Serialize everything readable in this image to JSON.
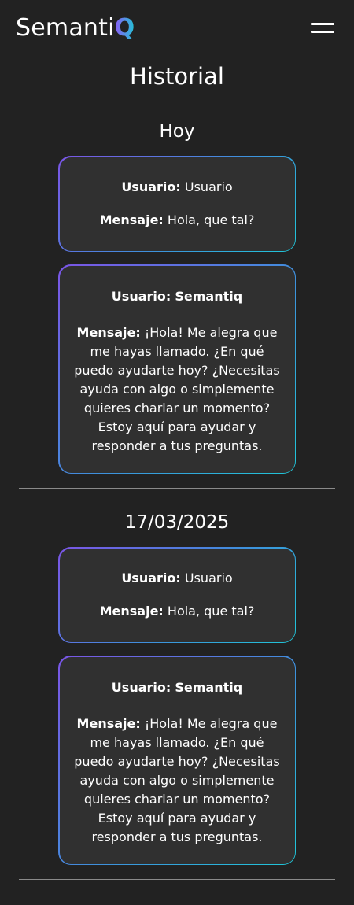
{
  "app": {
    "logo_text": "Semanti",
    "logo_accent": "Q",
    "accent_gradient": [
      "#8a5cf6",
      "#22c3d6"
    ]
  },
  "header": {
    "menu_icon": "hamburger-menu-icon"
  },
  "page": {
    "title": "Historial"
  },
  "sections": [
    {
      "date": "Hoy",
      "messages": [
        {
          "user_label": "Usuario:",
          "user_value": "Usuario",
          "message_label": "Mensaje:",
          "message_value": "Hola, que tal?"
        },
        {
          "user_label": "Usuario:",
          "user_value": "Semantiq",
          "message_label": "Mensaje:",
          "message_value": "¡Hola! Me alegra que me hayas llamado. ¿En qué puedo ayudarte hoy? ¿Necesitas ayuda con algo o simplemente quieres charlar un momento? Estoy aquí para ayudar y responder a tus preguntas."
        }
      ]
    },
    {
      "date": "17/03/2025",
      "messages": [
        {
          "user_label": "Usuario:",
          "user_value": "Usuario",
          "message_label": "Mensaje:",
          "message_value": "Hola, que tal?"
        },
        {
          "user_label": "Usuario:",
          "user_value": "Semantiq",
          "message_label": "Mensaje:",
          "message_value": "¡Hola! Me alegra que me hayas llamado. ¿En qué puedo ayudarte hoy? ¿Necesitas ayuda con algo o simplemente quieres charlar un momento? Estoy aquí para ayudar y responder a tus preguntas."
        }
      ]
    }
  ]
}
